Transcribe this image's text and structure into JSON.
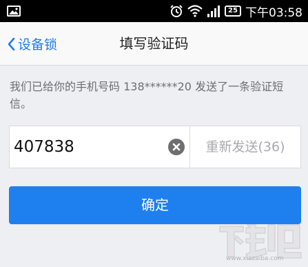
{
  "status_bar": {
    "battery": "25",
    "time": "下午03:58",
    "icons": [
      "gallery-icon",
      "alarm-icon",
      "wifi-icon",
      "signal-icon",
      "battery-icon"
    ]
  },
  "nav": {
    "back_label": "设备锁",
    "title": "填写验证码"
  },
  "hint": "我们已给你的手机号码 138******20 发送了一条验证短信。",
  "code_input": {
    "value": "407838"
  },
  "resend_label": "重新发送(36)",
  "confirm_label": "确定",
  "watermark": {
    "text": "下载吧",
    "url": "www.xiazaiba.com"
  },
  "colors": {
    "accent": "#1e80ef",
    "statusbar": "#000000",
    "background": "#eeeff3"
  }
}
